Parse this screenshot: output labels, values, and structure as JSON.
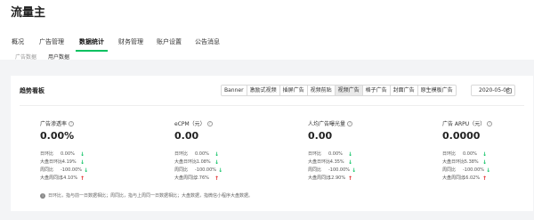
{
  "app": {
    "title": "流量主"
  },
  "nav": [
    {
      "label": "概况",
      "active": false
    },
    {
      "label": "广告管理",
      "active": false
    },
    {
      "label": "数据统计",
      "active": true
    },
    {
      "label": "财务管理",
      "active": false
    },
    {
      "label": "账户设置",
      "active": false
    },
    {
      "label": "公告消息",
      "active": false
    }
  ],
  "subnav": [
    {
      "label": "广告数据",
      "active": false
    },
    {
      "label": "用户数据",
      "active": true
    }
  ],
  "trend": {
    "title": "趋势看板",
    "segments": [
      {
        "label": "Banner",
        "active": false
      },
      {
        "label": "激励式视频",
        "active": false
      },
      {
        "label": "插屏广告",
        "active": false
      },
      {
        "label": "视频前贴",
        "active": false
      },
      {
        "label": "视频广告",
        "active": true
      },
      {
        "label": "格子广告",
        "active": false
      },
      {
        "label": "封面广告",
        "active": false
      },
      {
        "label": "原生模板广告",
        "active": false
      }
    ],
    "date": "2020-05-06",
    "note": "日环比，指与前一日数据相比；周同比，指与上周同一日数据相比；大盘数据，指微信小程序大盘数据。",
    "metrics": [
      {
        "label": "广告渗透率",
        "value": "0.00%",
        "rows": [
          {
            "label": "日环比",
            "value": "0.00%",
            "dir": "down"
          },
          {
            "label": "大盘日环比",
            "value": "-4.19%",
            "dir": "down"
          },
          {
            "label": "周同比",
            "value": "-100.00%",
            "dir": "down"
          },
          {
            "label": "大盘周同比",
            "value": "14.10%",
            "dir": "up"
          }
        ]
      },
      {
        "label": "eCPM（元）",
        "value": "0.00",
        "rows": [
          {
            "label": "日环比",
            "value": "0.00%",
            "dir": "down"
          },
          {
            "label": "大盘日环比",
            "value": "-1.08%",
            "dir": "down"
          },
          {
            "label": "周同比",
            "value": "-100.00%",
            "dir": "down"
          },
          {
            "label": "大盘周同比",
            "value": "2.76%",
            "dir": "up"
          }
        ]
      },
      {
        "label": "人均广告曝光量",
        "value": "0.00",
        "rows": [
          {
            "label": "日环比",
            "value": "0.00%",
            "dir": "down"
          },
          {
            "label": "大盘日环比",
            "value": "-4.35%",
            "dir": "down"
          },
          {
            "label": "周同比",
            "value": "-100.00%",
            "dir": "down"
          },
          {
            "label": "大盘周同比",
            "value": "12.90%",
            "dir": "up"
          }
        ]
      },
      {
        "label": "广告 ARPU（元）",
        "value": "0.0000",
        "rows": [
          {
            "label": "日环比",
            "value": "0.00%",
            "dir": "down"
          },
          {
            "label": "大盘日环比",
            "value": "-5.38%",
            "dir": "down"
          },
          {
            "label": "周同比",
            "value": "-100.00%",
            "dir": "down"
          },
          {
            "label": "大盘周同比",
            "value": "16.02%",
            "dir": "up"
          }
        ]
      }
    ]
  },
  "colors": {
    "accent": "#07c160",
    "down": "#07c160",
    "up": "#e02020"
  }
}
